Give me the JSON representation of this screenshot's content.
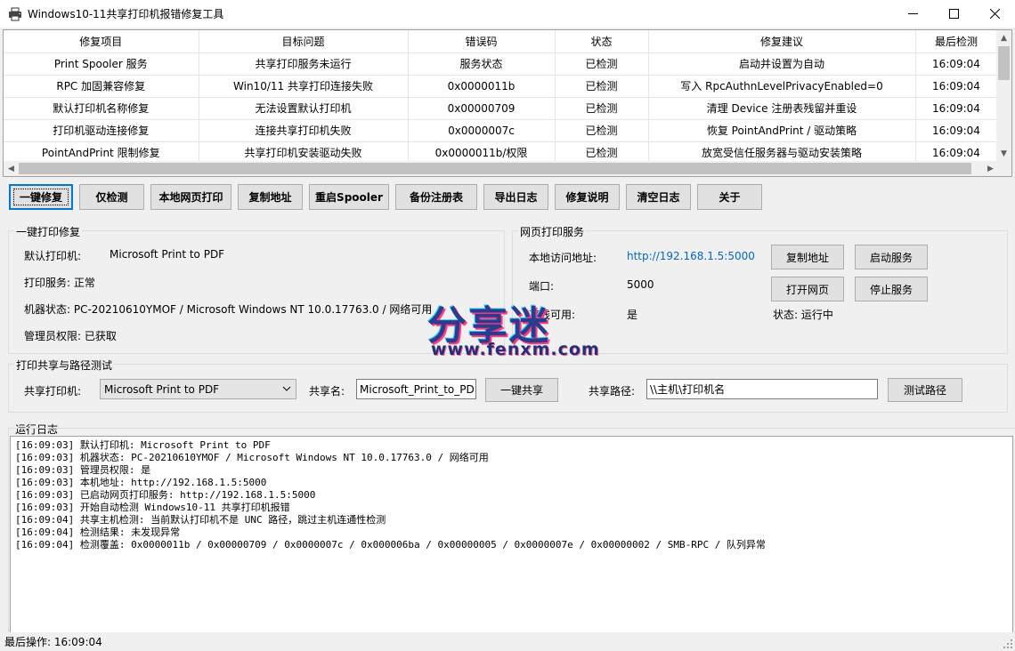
{
  "window": {
    "title": "Windows10-11共享打印机报错修复工具",
    "icon": "printer-icon"
  },
  "table": {
    "columns": [
      "修复项目",
      "目标问题",
      "错误码",
      "状态",
      "修复建议",
      "最后检测"
    ],
    "rows": [
      [
        "Print Spooler 服务",
        "共享打印服务未运行",
        "服务状态",
        "已检测",
        "启动并设置为自动",
        "16:09:04"
      ],
      [
        "RPC 加固兼容修复",
        "Win10/11 共享打印连接失败",
        "0x0000011b",
        "已检测",
        "写入 RpcAuthnLevelPrivacyEnabled=0",
        "16:09:04"
      ],
      [
        "默认打印机名称修复",
        "无法设置默认打印机",
        "0x00000709",
        "已检测",
        "清理 Device 注册表残留并重设",
        "16:09:04"
      ],
      [
        "打印机驱动连接修复",
        "连接共享打印机失败",
        "0x0000007c",
        "已检测",
        "恢复 PointAndPrint / 驱动策略",
        "16:09:04"
      ],
      [
        "PointAndPrint 限制修复",
        "共享打印机安装驱动失败",
        "0x0000011b/权限",
        "已检测",
        "放宽受信任服务器与驱动安装策略",
        "16:09:04"
      ]
    ]
  },
  "toolbar": {
    "one_click_fix": "一键修复",
    "detect_only": "仅检测",
    "local_web_print": "本地网页打印",
    "copy_address": "复制地址",
    "restart_spooler": "重启Spooler",
    "backup_registry": "备份注册表",
    "export_log": "导出日志",
    "fix_notes": "修复说明",
    "clear_log": "清空日志",
    "about": "关于"
  },
  "repair_group": {
    "title": "一键打印修复",
    "default_printer_label": "默认打印机:",
    "default_printer_value": "Microsoft Print to PDF",
    "print_service": "打印服务: 正常",
    "machine_status": "机器状态: PC-20210610YMOF / Microsoft Windows NT 10.0.17763.0 / 网络可用",
    "admin_rights": "管理员权限: 已获取"
  },
  "web_group": {
    "title": "网页打印服务",
    "local_address_label": "本地访问地址:",
    "local_address_value": "http://192.168.1.5:5000",
    "port_label": "端口:",
    "port_value": "5000",
    "offline_label": "离线可用:",
    "offline_value": "是",
    "copy_address_btn": "复制地址",
    "start_service_btn": "启动服务",
    "open_web_btn": "打开网页",
    "stop_service_btn": "停止服务",
    "status": "状态: 运行中"
  },
  "share_group": {
    "title": "打印共享与路径测试",
    "share_printer_label": "共享打印机:",
    "share_printer_value": "Microsoft Print to PDF",
    "share_name_label": "共享名:",
    "share_name_value": "Microsoft_Print_to_PDF",
    "one_click_share_btn": "一键共享",
    "share_path_label": "共享路径:",
    "share_path_value": "\\\\主机\\打印机名",
    "test_path_btn": "测试路径"
  },
  "log": {
    "title": "运行日志",
    "lines": [
      "[16:09:03] 默认打印机: Microsoft Print to PDF",
      "[16:09:03] 机器状态: PC-20210610YMOF / Microsoft Windows NT 10.0.17763.0 / 网络可用",
      "[16:09:03] 管理员权限: 是",
      "[16:09:03] 本机地址: http://192.168.1.5:5000",
      "[16:09:03] 已启动网页打印服务: http://192.168.1.5:5000",
      "[16:09:03] 开始自动检测 Windows10-11 共享打印机报错",
      "[16:09:04] 共享主机检测: 当前默认打印机不是 UNC 路径，跳过主机连通性检测",
      "[16:09:04] 检测结果: 未发现异常",
      "[16:09:04] 检测覆盖: 0x0000011b / 0x00000709 / 0x0000007c / 0x000006ba / 0x00000005 / 0x0000007e / 0x00000002 / SMB-RPC / 队列异常"
    ]
  },
  "status_bar": {
    "text": "最后操作: 16:09:04"
  },
  "watermark": {
    "big": "分享迷",
    "small": "www.fenxm.com"
  },
  "colors": {
    "accent": "#0078d7",
    "link": "#0066cc",
    "window_bg": "#f0f0f0"
  }
}
